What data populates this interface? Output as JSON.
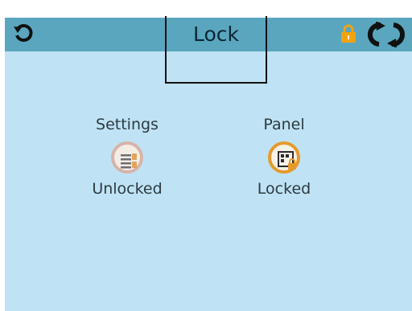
{
  "header": {
    "title": "Lock",
    "back_icon": "undo-arrow-icon",
    "lock_icon": "padlock-icon",
    "sync_icon": "sync-arrows-icon"
  },
  "items": [
    {
      "label": "Settings",
      "status": "Unlocked",
      "icon": "settings-sliders-icon"
    },
    {
      "label": "Panel",
      "status": "Locked",
      "icon": "locked-panel-icon"
    }
  ],
  "colors": {
    "background": "#bfe3f4",
    "header": "#5aa6bf",
    "lock_accent": "#f2a20f"
  }
}
